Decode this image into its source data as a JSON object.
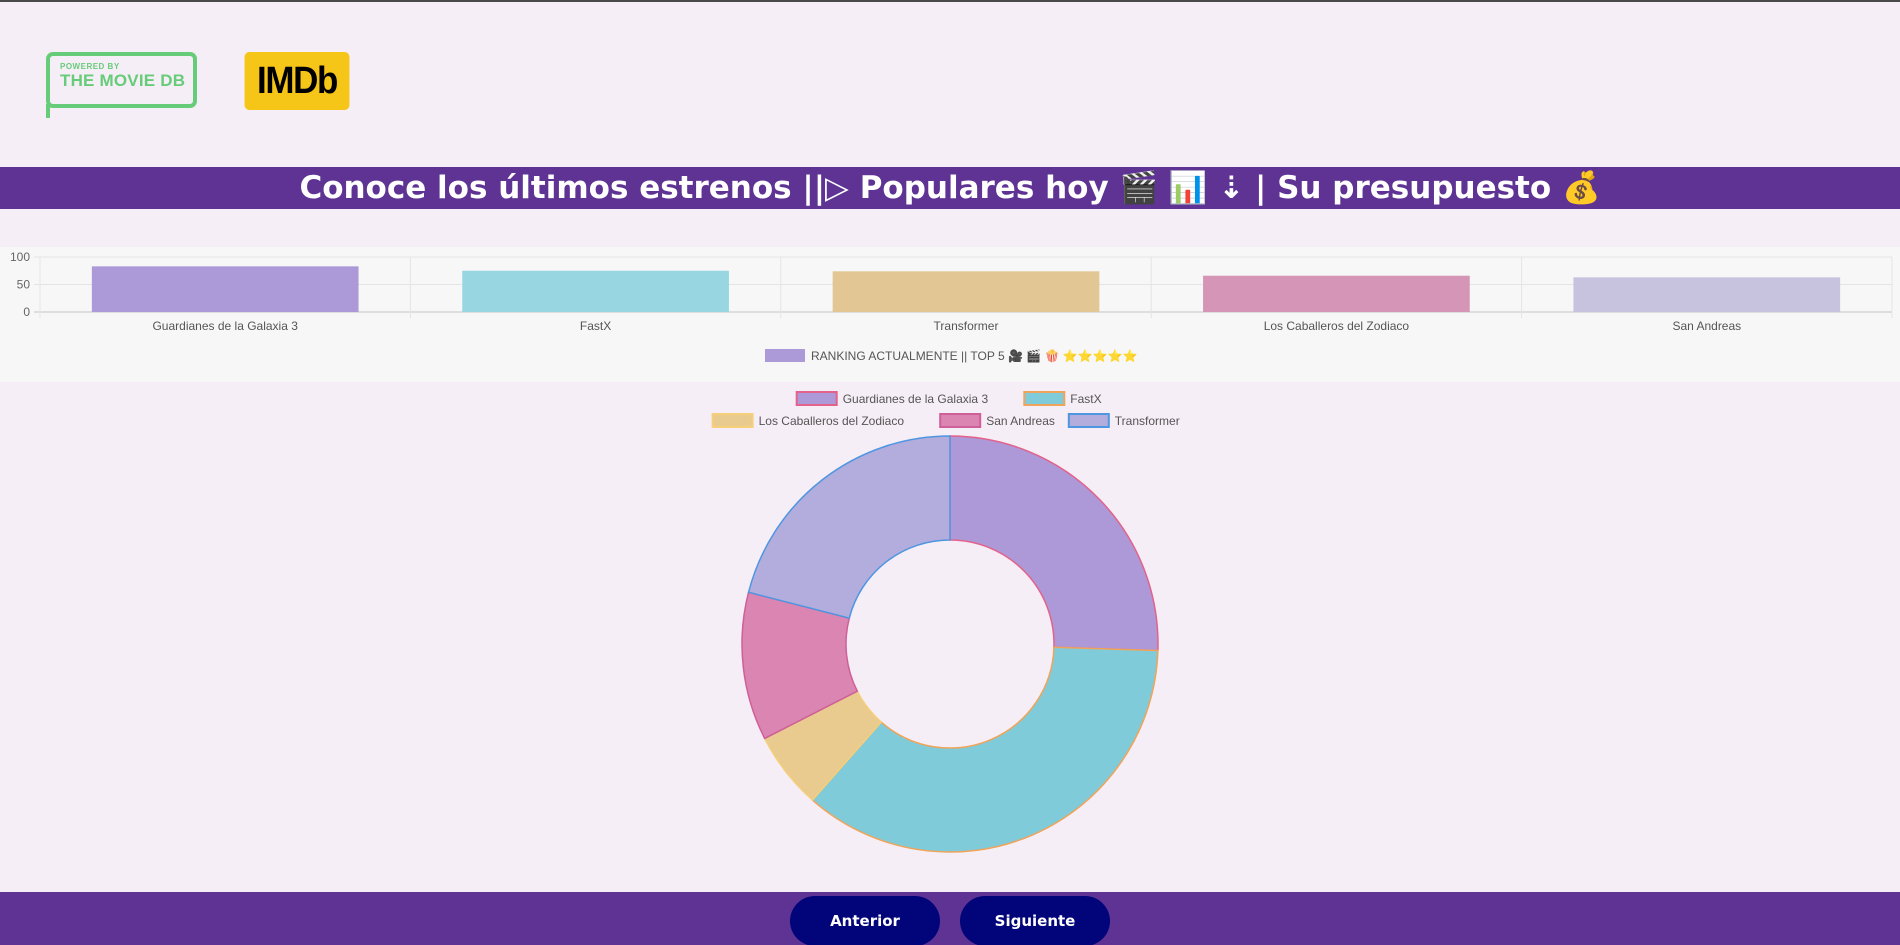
{
  "logos": {
    "tmdb_small": "POWERED BY",
    "tmdb_big": "THE MOVIE DB",
    "imdb": "IMDb"
  },
  "banner": {
    "title": "Conoce los últimos estrenos ||▷ Populares hoy 🎬 📊 ⇣ | Su presupuesto 💰"
  },
  "chart_data": [
    {
      "type": "bar",
      "categories": [
        "Guardianes de la Galaxia 3",
        "FastX",
        "Transformer",
        "Los Caballeros del Zodiaco",
        "San Andreas"
      ],
      "series": [
        {
          "name": "RANKING ACTUALMENTE || TOP 5 🎥 🎬 🍿 ⭐⭐⭐⭐⭐",
          "values": [
            83,
            75,
            74,
            66,
            63
          ]
        }
      ],
      "ylim": [
        0,
        100
      ],
      "yticks": [
        0,
        50,
        100
      ],
      "grid": true,
      "legend": "bottom",
      "colors": [
        "#ab99d8",
        "#98d6e2",
        "#e2c795",
        "#d595b6",
        "#c7c3df"
      ]
    },
    {
      "type": "pie",
      "variant": "doughnut",
      "labels": [
        "Guardianes de la Galaxia 3",
        "FastX",
        "Los Caballeros del Zodiaco",
        "San Andreas",
        "Transformer"
      ],
      "values": [
        25.5,
        36.0,
        6.0,
        11.5,
        21.0
      ],
      "legend": "top",
      "fill_colors": [
        "#ad98d8",
        "#80cbd9",
        "#e9ca8f",
        "#db85b2",
        "#b2addc"
      ],
      "border_colors": [
        "#e3628a",
        "#f0a45a",
        "#f5cf7a",
        "#cf5f98",
        "#4f96e0"
      ]
    }
  ],
  "footer": {
    "prev_label": "Anterior",
    "next_label": "Siguiente"
  }
}
